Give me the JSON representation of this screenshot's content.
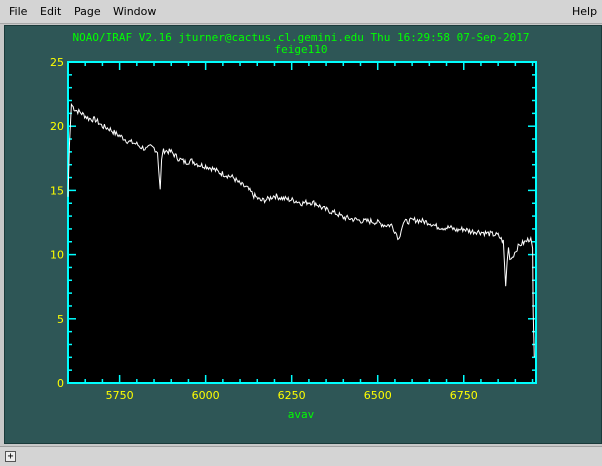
{
  "menu": {
    "file": "File",
    "edit": "Edit",
    "page": "Page",
    "window": "Window",
    "help": "Help"
  },
  "plot": {
    "header": "NOAO/IRAF V2.16 jturner@cactus.cl.gemini.edu Thu 16:29:58 07-Sep-2017",
    "object": "feige110",
    "xlabel": "avav",
    "colors": {
      "window_bg": "#2e5656",
      "frame": "#00ffff",
      "title": "#00ff00",
      "ticks": "#ffff00",
      "data": "#ffffff"
    }
  },
  "chart_data": {
    "type": "line",
    "xlim": [
      5600,
      6960
    ],
    "ylim": [
      0,
      25
    ],
    "xticks": [
      5750,
      6000,
      6250,
      6500,
      6750
    ],
    "yticks": [
      0,
      5,
      10,
      15,
      20,
      25
    ],
    "series": [
      {
        "x": [
          5600,
          5604,
          5610,
          5615,
          5620,
          5640,
          5660,
          5680,
          5700,
          5720,
          5740,
          5760,
          5775,
          5790,
          5800,
          5810,
          5820,
          5830,
          5840,
          5850,
          5860,
          5868,
          5872,
          5875,
          5880,
          5900,
          5920,
          5940,
          5960,
          5980,
          6000,
          6020,
          6040,
          6060,
          6080,
          6100,
          6120,
          6140,
          6160,
          6180,
          6200,
          6220,
          6240,
          6260,
          6280,
          6300,
          6320,
          6340,
          6360,
          6380,
          6400,
          6420,
          6440,
          6460,
          6480,
          6500,
          6520,
          6540,
          6555,
          6562,
          6568,
          6575,
          6590,
          6610,
          6630,
          6650,
          6670,
          6690,
          6710,
          6730,
          6750,
          6770,
          6790,
          6810,
          6830,
          6850,
          6865,
          6872,
          6876,
          6880,
          6884,
          6888,
          6895,
          6905,
          6915,
          6930,
          6945,
          6950,
          6952,
          6955
        ],
        "y": [
          14.5,
          18.5,
          21.7,
          21.5,
          21.3,
          21.0,
          20.6,
          20.5,
          20.0,
          19.8,
          19.4,
          19.1,
          18.8,
          18.7,
          18.6,
          18.4,
          18.3,
          18.2,
          18.4,
          18.3,
          18.0,
          15.0,
          17.3,
          18.0,
          18.1,
          18.0,
          17.5,
          17.2,
          17.3,
          17.0,
          16.9,
          16.7,
          16.4,
          16.2,
          16.0,
          15.5,
          15.2,
          14.6,
          14.2,
          14.3,
          14.6,
          14.4,
          14.3,
          14.2,
          14.0,
          14.1,
          14.0,
          13.6,
          13.4,
          13.2,
          12.9,
          12.8,
          12.7,
          12.6,
          12.6,
          12.5,
          12.3,
          12.3,
          11.6,
          11.2,
          12.0,
          12.5,
          12.6,
          12.7,
          12.6,
          12.5,
          12.2,
          12.1,
          12.1,
          11.9,
          12.0,
          11.8,
          11.8,
          11.7,
          11.6,
          11.5,
          11.0,
          7.5,
          9.5,
          10.5,
          9.8,
          9.7,
          10.0,
          10.5,
          10.8,
          11.0,
          11.3,
          10.5,
          5.5,
          2.0
        ]
      }
    ]
  }
}
